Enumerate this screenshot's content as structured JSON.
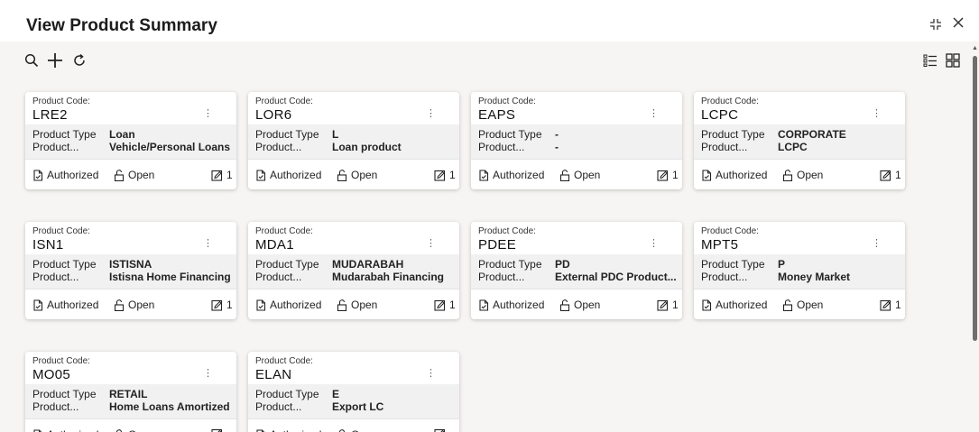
{
  "window": {
    "title": "View Product Summary",
    "maximize_icon": "⬌",
    "close_icon": "✕"
  },
  "toolbar": {
    "icons": [
      "search-icon",
      "add-icon",
      "refresh-icon"
    ],
    "view_icons": [
      "list-view-icon",
      "tile-view-icon"
    ]
  },
  "card_labels": {
    "code_label": "Product Code:",
    "type_label": "Product Type",
    "desc_label": "Product...",
    "authorized": "Authorized",
    "open": "Open"
  },
  "cards": [
    {
      "code": "LRE2",
      "type": "Loan",
      "desc": "Vehicle/Personal Loans",
      "edits": "1"
    },
    {
      "code": "LOR6",
      "type": "L",
      "desc": "Loan product",
      "edits": "1"
    },
    {
      "code": "EAPS",
      "type": "-",
      "desc": "-",
      "edits": "1"
    },
    {
      "code": "LCPC",
      "type": "CORPORATE",
      "desc": "LCPC",
      "edits": "1"
    },
    {
      "code": "ISN1",
      "type": "ISTISNA",
      "desc": "Istisna Home Financing",
      "edits": "1"
    },
    {
      "code": "MDA1",
      "type": "MUDARABAH",
      "desc": "Mudarabah Financing",
      "edits": "1"
    },
    {
      "code": "PDEE",
      "type": "PD",
      "desc": "External PDC Product...",
      "edits": "1"
    },
    {
      "code": "MPT5",
      "type": "P",
      "desc": "Money Market",
      "edits": "1"
    },
    {
      "code": "MO05",
      "type": "RETAIL",
      "desc": "Home Loans Amortized",
      "edits": ""
    },
    {
      "code": "ELAN",
      "type": "E",
      "desc": "Export LC",
      "edits": ""
    }
  ],
  "colors": {
    "background": "#f6f5f3",
    "card": "#ffffff",
    "card_body": "#f1f1f1"
  }
}
